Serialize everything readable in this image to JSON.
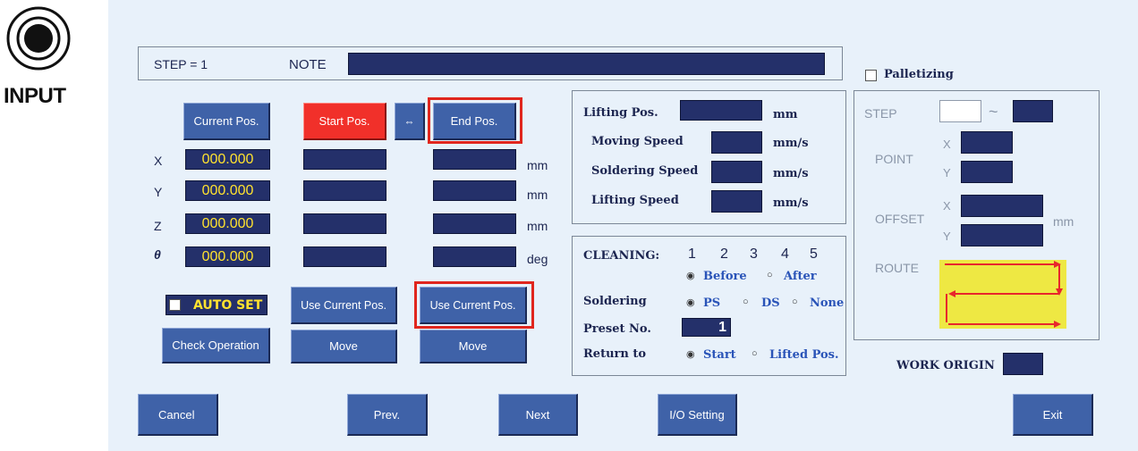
{
  "left": {
    "input_label": "INPUT"
  },
  "top_bar": {
    "step": "STEP = 1",
    "note_label": "NOTE",
    "note_value": ""
  },
  "palletizing": {
    "label": "Palletizing",
    "checked": false
  },
  "buttons": {
    "current_pos": "Current Pos.",
    "start_pos": "Start Pos.",
    "swap": "⇔",
    "end_pos": "End Pos.",
    "use_current_pos_start": "Use Current Pos.",
    "use_current_pos_end": "Use Current Pos.",
    "check_operation": "Check Operation",
    "move_start": "Move",
    "move_end": "Move",
    "cancel": "Cancel",
    "prev": "Prev.",
    "next": "Next",
    "io_setting": "I/O Setting",
    "exit": "Exit"
  },
  "axes": [
    {
      "name": "X",
      "current": "000.000",
      "unit": "mm"
    },
    {
      "name": "Y",
      "current": "000.000",
      "unit": "mm"
    },
    {
      "name": "Z",
      "current": "000.000",
      "unit": "mm"
    },
    {
      "name": "θ",
      "current": "000.000",
      "unit": "deg"
    }
  ],
  "auto_set": {
    "label": "AUTO SET",
    "checked": false
  },
  "lifting": {
    "pos_label": "Lifting Pos.",
    "pos_unit": "mm",
    "moving_label": "Moving Speed",
    "moving_unit": "mm/s",
    "soldering_label": "Soldering Speed",
    "soldering_unit": "mm/s",
    "lifting_label": "Lifting Speed",
    "lifting_unit": "mm/s"
  },
  "cleaning": {
    "label": "CLEANING:",
    "numbers": [
      "1",
      "2",
      "3",
      "4",
      "5"
    ],
    "before": "Before",
    "after": "After",
    "selected": "Before"
  },
  "soldering": {
    "label": "Soldering",
    "options": [
      "PS",
      "DS",
      "None"
    ],
    "selected": "PS"
  },
  "preset": {
    "label": "Preset No.",
    "value": "1"
  },
  "return_to": {
    "label": "Return to",
    "options": [
      "Start",
      "Lifted Pos."
    ],
    "selected": "Start"
  },
  "pallet": {
    "step_label": "STEP",
    "tilde": "~",
    "point_label": "POINT",
    "x": "X",
    "y": "Y",
    "offset_label": "OFFSET",
    "offset_unit": "mm",
    "route_label": "ROUTE",
    "route_color": "#eee843",
    "route_arrow_color": "#e8262c"
  },
  "work_origin": {
    "label": "WORK ORIGIN"
  },
  "colors": {
    "button": "#3f62a8",
    "highlight": "#e0261d",
    "field": "#24306a",
    "value_text": "#ffe22f"
  }
}
